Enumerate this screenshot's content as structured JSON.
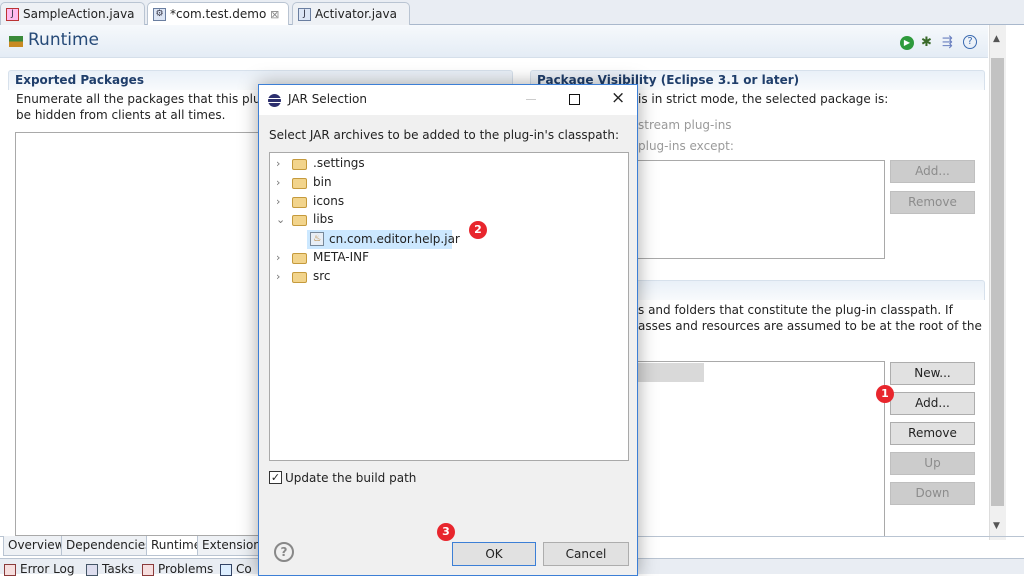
{
  "editor_tabs": [
    {
      "label": "SampleAction.java"
    },
    {
      "label": "*com.test.demo",
      "close": "⊠"
    },
    {
      "label": "Activator.java"
    }
  ],
  "header": {
    "title": "Runtime"
  },
  "toolbar_icons": [
    "run-icon",
    "debug-icon",
    "export-icon",
    "help-icon"
  ],
  "exported": {
    "title": "Exported Packages",
    "line1": "Enumerate all the packages that this plug-in",
    "line2": "be hidden from clients at all times."
  },
  "visibility": {
    "title": "Package Visibility (Eclipse 3.1 or later)",
    "line1": "is in strict mode, the selected package is:",
    "option1": "stream plug-ins",
    "option2": "plug-ins except:",
    "add": "Add...",
    "remove": "Remove"
  },
  "classpath": {
    "line1": "s and folders that constitute the plug-in classpath.  If",
    "line2": "asses and resources are assumed to be at the root of the",
    "buttons": {
      "new": "New...",
      "add": "Add...",
      "remove": "Remove",
      "up": "Up",
      "down": "Down"
    }
  },
  "form_tabs": [
    "Overview",
    "Dependencies",
    "Runtime",
    "Extensions"
  ],
  "view_tabs": [
    "Error Log",
    "Tasks",
    "Problems",
    "Co"
  ],
  "dialog": {
    "title": "JAR Selection",
    "prompt": "Select JAR archives to be added to the plug-in's classpath:",
    "tree": [
      {
        "label": ".settings",
        "exp": "›"
      },
      {
        "label": "bin",
        "exp": "›"
      },
      {
        "label": "icons",
        "exp": "›"
      },
      {
        "label": "libs",
        "exp": "⌄"
      },
      {
        "label": "cn.com.editor.help.jar"
      },
      {
        "label": "META-INF",
        "exp": "›"
      },
      {
        "label": "src",
        "exp": "›"
      }
    ],
    "checkbox": "Update the build path",
    "checkbox_checked": true,
    "ok": "OK",
    "cancel": "Cancel",
    "help": "?"
  },
  "badges": [
    "1",
    "2",
    "3"
  ],
  "colors": {
    "badge": "#e8262d",
    "selection": "#cce8ff",
    "header_text": "#264a78"
  }
}
